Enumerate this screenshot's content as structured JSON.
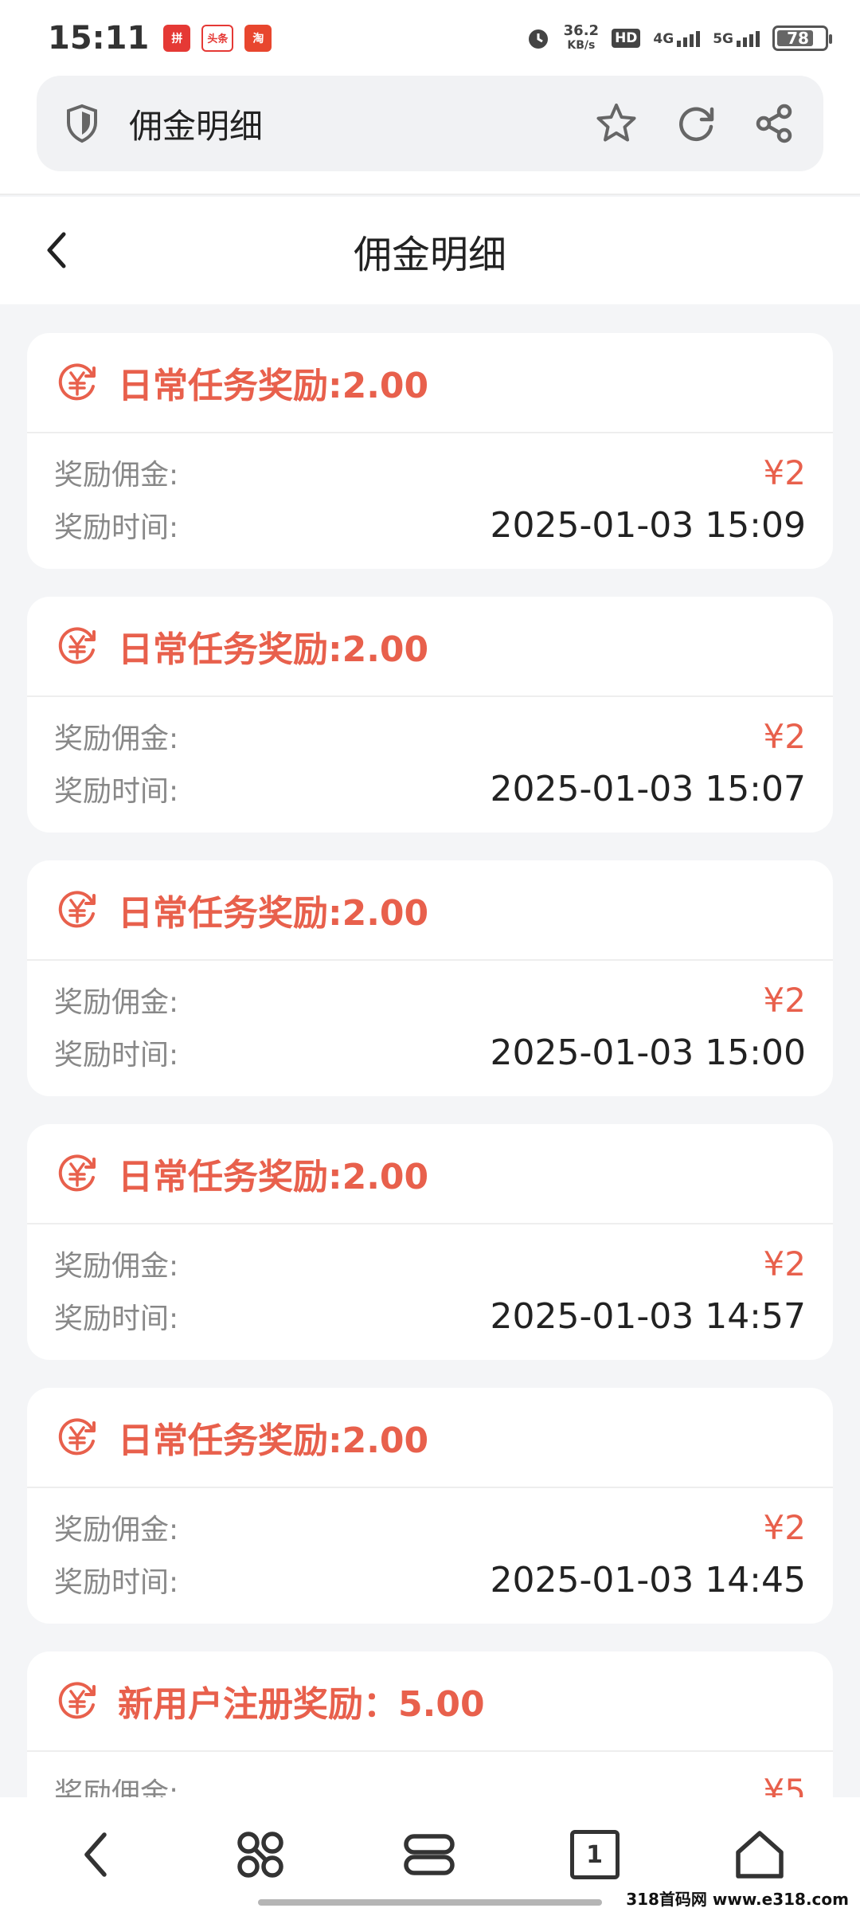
{
  "status_bar": {
    "time": "15:11",
    "app_icons": [
      "拼",
      "头条",
      "淘"
    ],
    "net_speed_value": "36.2",
    "net_speed_unit": "KB/s",
    "hd_label": "HD",
    "signal_1": "4G",
    "signal_2": "5G",
    "battery": "78"
  },
  "browser": {
    "address_title": "佣金明细"
  },
  "page": {
    "title": "佣金明细"
  },
  "labels": {
    "reward_commission": "奖励佣金:",
    "reward_time": "奖励时间:"
  },
  "cards": [
    {
      "title": "日常任务奖励:2.00",
      "amount": "¥2",
      "time": "2025-01-03 15:09"
    },
    {
      "title": "日常任务奖励:2.00",
      "amount": "¥2",
      "time": "2025-01-03 15:07"
    },
    {
      "title": "日常任务奖励:2.00",
      "amount": "¥2",
      "time": "2025-01-03 15:00"
    },
    {
      "title": "日常任务奖励:2.00",
      "amount": "¥2",
      "time": "2025-01-03 14:57"
    },
    {
      "title": "日常任务奖励:2.00",
      "amount": "¥2",
      "time": "2025-01-03 14:45"
    },
    {
      "title": "新用户注册奖励：5.00",
      "amount": "¥5",
      "time": ""
    }
  ],
  "bottom_nav": {
    "tab_count": "1"
  },
  "watermark": "318首码网 www.e318.com",
  "colors": {
    "accent": "#e8604c",
    "background": "#f4f5f7"
  },
  "icons": [
    "shield-icon",
    "star-icon",
    "refresh-icon",
    "share-icon",
    "back-icon",
    "yuan-icon",
    "menu-icon",
    "tabs-icon",
    "home-icon"
  ]
}
